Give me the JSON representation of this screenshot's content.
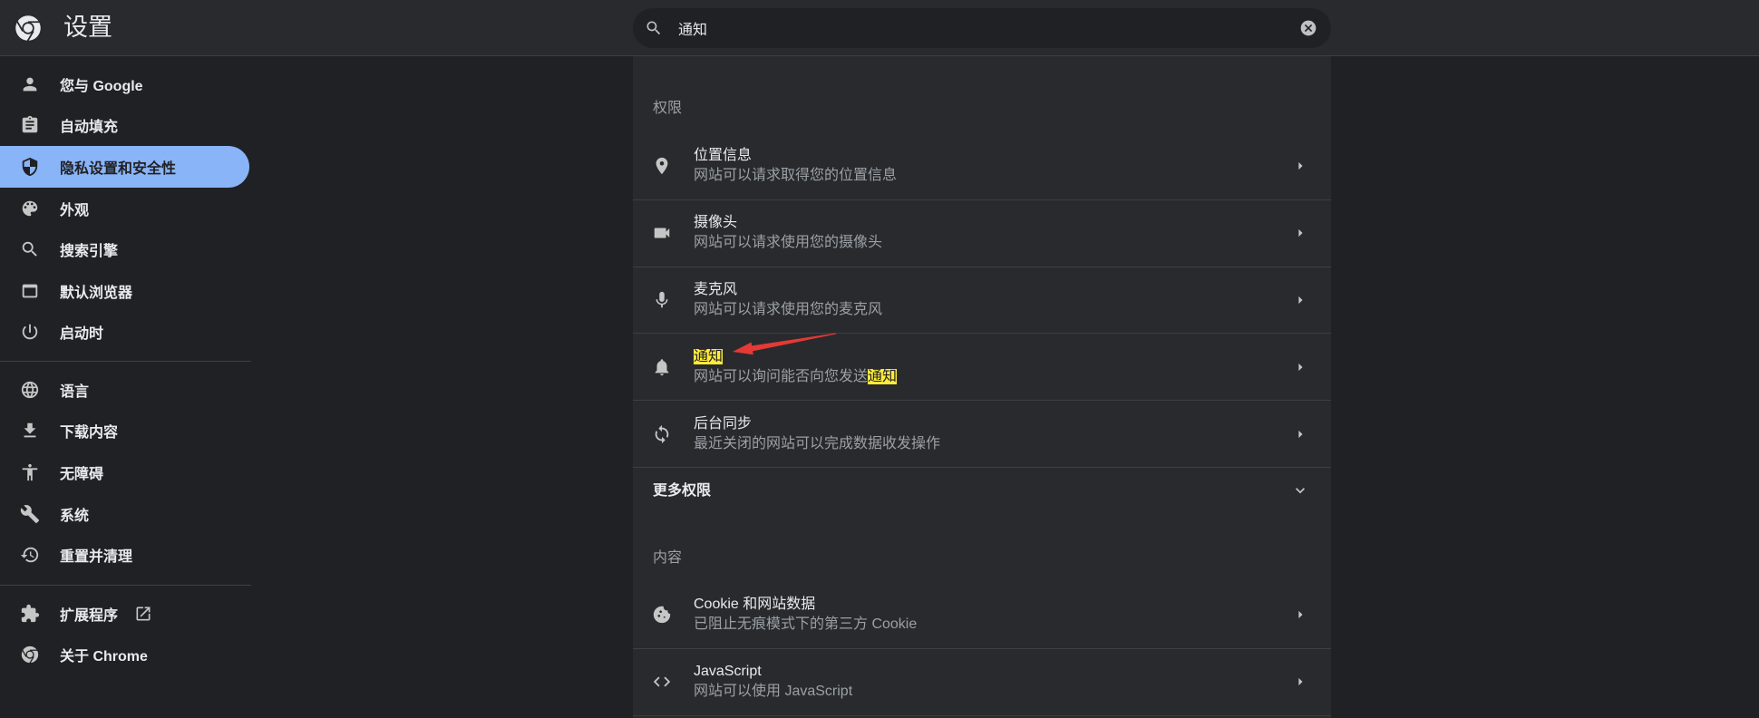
{
  "app": {
    "title": "设置"
  },
  "search": {
    "value": "通知"
  },
  "sidebar": {
    "items": [
      {
        "label": "您与 Google",
        "icon": "person-icon"
      },
      {
        "label": "自动填充",
        "icon": "clipboard-icon"
      },
      {
        "label": "隐私设置和安全性",
        "icon": "shield-icon",
        "selected": true
      },
      {
        "label": "外观",
        "icon": "palette-icon"
      },
      {
        "label": "搜索引擎",
        "icon": "search-icon"
      },
      {
        "label": "默认浏览器",
        "icon": "browser-icon"
      },
      {
        "label": "启动时",
        "icon": "power-icon"
      },
      {
        "label": "语言",
        "icon": "globe-icon"
      },
      {
        "label": "下载内容",
        "icon": "download-icon"
      },
      {
        "label": "无障碍",
        "icon": "accessibility-icon"
      },
      {
        "label": "系统",
        "icon": "wrench-icon"
      },
      {
        "label": "重置并清理",
        "icon": "restore-icon"
      },
      {
        "label": "扩展程序",
        "icon": "puzzle-icon",
        "trailing_icon": "open-in-new-icon"
      },
      {
        "label": "关于 Chrome",
        "icon": "chrome-icon"
      }
    ]
  },
  "permissions": {
    "heading": "权限",
    "rows": [
      {
        "title": "位置信息",
        "subtitle": "网站可以请求取得您的位置信息",
        "icon": "location-icon"
      },
      {
        "title": "摄像头",
        "subtitle": "网站可以请求使用您的摄像头",
        "icon": "camera-icon"
      },
      {
        "title": "麦克风",
        "subtitle": "网站可以请求使用您的麦克风",
        "icon": "microphone-icon"
      },
      {
        "title": "通知",
        "title_highlighted": true,
        "subtitle": "网站可以询问能否向您发送",
        "subtitle_highlight": "通知",
        "icon": "bell-icon"
      },
      {
        "title": "后台同步",
        "subtitle": "最近关闭的网站可以完成数据收发操作",
        "icon": "sync-icon"
      }
    ],
    "more": {
      "label": "更多权限",
      "icon": "chevron-down-icon"
    }
  },
  "content": {
    "heading": "内容",
    "rows": [
      {
        "title": "Cookie 和网站数据",
        "subtitle": "已阻止无痕模式下的第三方 Cookie",
        "icon": "cookie-icon"
      },
      {
        "title": "JavaScript",
        "subtitle": "网站可以使用 JavaScript",
        "icon": "code-icon"
      }
    ]
  },
  "colors": {
    "background": "#202124",
    "header": "#292a2d",
    "card": "#292a2d",
    "accent": "#8ab4f8",
    "search_highlight": "#ffeb3b",
    "annotation": "#e53935"
  }
}
